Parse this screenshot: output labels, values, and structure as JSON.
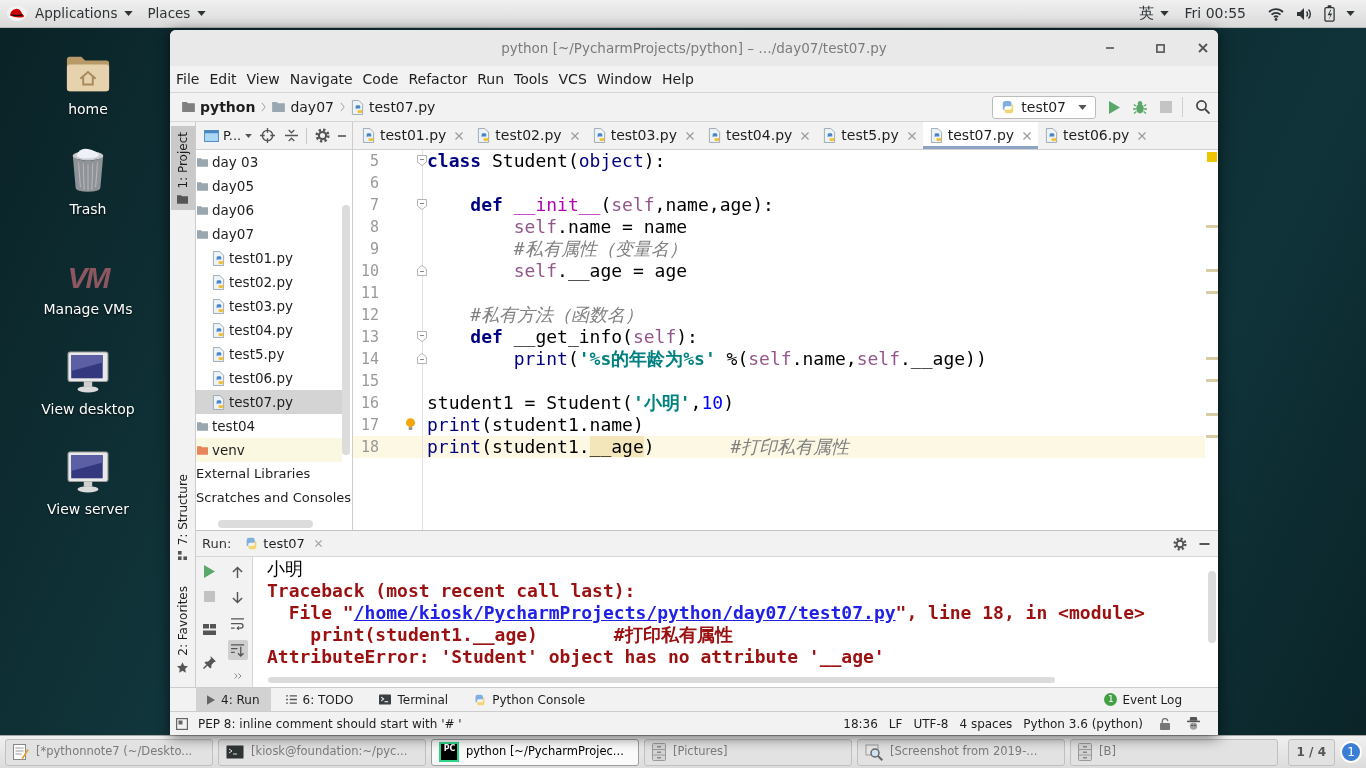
{
  "top_bar": {
    "menus": [
      "Applications",
      "Places"
    ],
    "input_method": "英",
    "clock": "Fri 00:55"
  },
  "desktop_icons": [
    {
      "kind": "home",
      "label": "home"
    },
    {
      "kind": "trash",
      "label": "Trash"
    },
    {
      "kind": "vm",
      "logo": "VM",
      "label": "Manage VMs"
    },
    {
      "kind": "monitor",
      "label": "View desktop"
    },
    {
      "kind": "monitor",
      "label": "View server"
    }
  ],
  "window": {
    "title": "python [~/PycharmProjects/python] – …/day07/test07.py",
    "menu": [
      "File",
      "Edit",
      "View",
      "Navigate",
      "Code",
      "Refactor",
      "Run",
      "Tools",
      "VCS",
      "Window",
      "Help"
    ],
    "breadcrumbs": [
      {
        "kind": "project",
        "label": "python"
      },
      {
        "kind": "folder",
        "label": "day07"
      },
      {
        "kind": "python_file",
        "label": "test07.py"
      }
    ],
    "run_config": "test07",
    "toolbar": [
      {
        "kind": "run",
        "disabled": false
      },
      {
        "kind": "debug",
        "disabled": false
      },
      {
        "kind": "stop",
        "disabled": true
      },
      {
        "kind": "search",
        "disabled": false
      }
    ],
    "side_tabs": [
      {
        "kind": "project",
        "label": "1: Project",
        "selected": true
      },
      {
        "kind": "structure",
        "label": "7: Structure",
        "selected": false
      },
      {
        "kind": "favorites",
        "label": "2: Favorites",
        "selected": false
      }
    ],
    "project_panel": {
      "view": "P...",
      "tree": [
        {
          "kind": "folder",
          "label": "day 03",
          "selected": false
        },
        {
          "kind": "folder",
          "label": "day05",
          "selected": false
        },
        {
          "kind": "folder",
          "label": "day06",
          "selected": false
        },
        {
          "kind": "folder",
          "label": "day07",
          "selected": false,
          "children": [
            {
              "kind": "python_file",
              "label": "test01.py",
              "selected": false
            },
            {
              "kind": "python_file",
              "label": "test02.py",
              "selected": false
            },
            {
              "kind": "python_file",
              "label": "test03.py",
              "selected": false
            },
            {
              "kind": "python_file",
              "label": "test04.py",
              "selected": false
            },
            {
              "kind": "python_file",
              "label": "test5.py",
              "selected": false
            },
            {
              "kind": "python_file",
              "label": "test06.py",
              "selected": false
            },
            {
              "kind": "python_file",
              "label": "test07.py",
              "selected": true
            }
          ]
        },
        {
          "kind": "folder",
          "label": "test04",
          "selected": false
        },
        {
          "kind": "excluded_folder",
          "label": "venv",
          "selected": false
        },
        {
          "kind": "libraries",
          "label": "External Libraries",
          "selected": false
        },
        {
          "kind": "scratches",
          "label": "Scratches and Consoles",
          "selected": false
        }
      ]
    },
    "editor_tabs": [
      {
        "label": "test01.py",
        "selected": false
      },
      {
        "label": "test02.py",
        "selected": false
      },
      {
        "label": "test03.py",
        "selected": false
      },
      {
        "label": "test04.py",
        "selected": false
      },
      {
        "label": "test5.py",
        "selected": false
      },
      {
        "label": "test07.py",
        "selected": true
      },
      {
        "label": "test06.py",
        "selected": false
      }
    ],
    "editor": {
      "lines": [
        {
          "number": "5",
          "fold_start": true,
          "tokens": [
            {
              "kind": "keyword",
              "text": "class "
            },
            {
              "kind": "plain",
              "text": "Student("
            },
            {
              "kind": "builtin",
              "text": "object"
            },
            {
              "kind": "plain",
              "text": "):"
            }
          ]
        },
        {
          "number": "6"
        },
        {
          "number": "7",
          "fold_start": true,
          "tokens": [
            {
              "kind": "keyword",
              "text": "    def "
            },
            {
              "kind": "magic",
              "text": "__init__"
            },
            {
              "kind": "plain",
              "text": "("
            },
            {
              "kind": "self",
              "text": "self"
            },
            {
              "kind": "plain",
              "text": ",name,age):"
            }
          ]
        },
        {
          "number": "8",
          "tokens": [
            {
              "kind": "self",
              "text": "        self"
            },
            {
              "kind": "plain",
              "text": ".name = name"
            }
          ]
        },
        {
          "number": "9",
          "tokens": [
            {
              "kind": "comment",
              "text": "        #私有属性（变量名）"
            }
          ]
        },
        {
          "number": "10",
          "fold_end": true,
          "tokens": [
            {
              "kind": "self",
              "text": "        self"
            },
            {
              "kind": "plain",
              "text": ".__age = age"
            }
          ]
        },
        {
          "number": "11"
        },
        {
          "number": "12",
          "tokens": [
            {
              "kind": "comment",
              "text": "    #私有方法（函数名）"
            }
          ]
        },
        {
          "number": "13",
          "fold_start": true,
          "tokens": [
            {
              "kind": "keyword",
              "text": "    def "
            },
            {
              "kind": "plain",
              "text": "__get_info("
            },
            {
              "kind": "self",
              "text": "self"
            },
            {
              "kind": "plain",
              "text": "):"
            }
          ]
        },
        {
          "number": "14",
          "fold_end": true,
          "tokens": [
            {
              "kind": "builtin",
              "text": "        print"
            },
            {
              "kind": "plain",
              "text": "("
            },
            {
              "kind": "string",
              "text": "'%s的年龄为%s'"
            },
            {
              "kind": "plain",
              "text": " %("
            },
            {
              "kind": "self",
              "text": "self"
            },
            {
              "kind": "plain",
              "text": ".name,"
            },
            {
              "kind": "self",
              "text": "self"
            },
            {
              "kind": "plain",
              "text": ".__age))"
            }
          ]
        },
        {
          "number": "15"
        },
        {
          "number": "16",
          "tokens": [
            {
              "kind": "plain",
              "text": "student1 = Student("
            },
            {
              "kind": "string",
              "text": "'小明'"
            },
            {
              "kind": "plain",
              "text": ","
            },
            {
              "kind": "number",
              "text": "10"
            },
            {
              "kind": "plain",
              "text": ")"
            }
          ]
        },
        {
          "number": "17",
          "bulb": true,
          "tokens": [
            {
              "kind": "builtin",
              "text": "print"
            },
            {
              "kind": "plain",
              "text": "(student1.name)"
            }
          ]
        },
        {
          "number": "18",
          "current": true,
          "tokens": [
            {
              "kind": "builtin",
              "text": "print"
            },
            {
              "kind": "plain",
              "text": "(student1."
            },
            {
              "kind": "unresolved",
              "text": "__age"
            },
            {
              "kind": "plain",
              "text": ")       "
            },
            {
              "kind": "comment",
              "text": "#打印私有属性"
            }
          ]
        }
      ]
    },
    "run_panel": {
      "label": "Run:",
      "tab": "test07",
      "actions": [
        {
          "kind": "rerun",
          "disabled": false
        },
        {
          "kind": "stop",
          "disabled": true
        },
        {
          "kind": "layout",
          "disabled": false
        },
        {
          "kind": "pin",
          "disabled": false
        }
      ],
      "options": [
        {
          "kind": "up",
          "on": false
        },
        {
          "kind": "down",
          "on": false
        },
        {
          "kind": "wrap",
          "on": false
        },
        {
          "kind": "scroll_end",
          "on": true
        },
        {
          "kind": "more",
          "on": false
        }
      ],
      "output": [
        {
          "kind": "stdout",
          "segments": [
            {
              "kind": "text",
              "text": "小明"
            }
          ]
        },
        {
          "kind": "stderr",
          "segments": [
            {
              "kind": "text",
              "text": "Traceback (most recent call last):"
            }
          ]
        },
        {
          "kind": "stderr",
          "segments": [
            {
              "kind": "text",
              "text": "  File \""
            },
            {
              "kind": "link",
              "text": "/home/kiosk/PycharmProjects/python/day07/test07.py"
            },
            {
              "kind": "text",
              "text": "\", line 18, in <module>"
            }
          ]
        },
        {
          "kind": "stderr",
          "segments": [
            {
              "kind": "text",
              "text": "    print(student1.__age)       #打印私有属性"
            }
          ]
        },
        {
          "kind": "stderr",
          "segments": [
            {
              "kind": "text",
              "text": "AttributeError: 'Student' object has no attribute '__age'"
            }
          ]
        }
      ]
    },
    "tool_windows": [
      {
        "kind": "run",
        "label": "4: Run",
        "selected": true
      },
      {
        "kind": "todo",
        "label": "6: TODO",
        "selected": false
      },
      {
        "kind": "terminal",
        "label": "Terminal",
        "selected": false
      },
      {
        "kind": "console",
        "label": "Python Console",
        "selected": false
      }
    ],
    "event_log": {
      "label": "Event Log",
      "count": "1"
    },
    "status_bar": {
      "message": "PEP 8: inline comment should start with '# '",
      "items": [
        "18:36",
        "LF",
        "UTF-8",
        "4 spaces",
        "Python 3.6 (python)"
      ]
    }
  },
  "taskbar": {
    "items": [
      {
        "kind": "editor",
        "label": "[*pythonnote7 (~/Deskto...",
        "selected": false
      },
      {
        "kind": "terminal",
        "label": "[kiosk@foundation:~/pyc...",
        "selected": false
      },
      {
        "kind": "pycharm",
        "logo": "PC",
        "label": "python [~/PycharmProjec...",
        "selected": true
      },
      {
        "kind": "files",
        "label": "[Pictures]",
        "selected": false
      },
      {
        "kind": "image_viewer",
        "label": "[Screenshot from 2019-...",
        "selected": false
      },
      {
        "kind": "files",
        "label": "[B]",
        "selected": false
      }
    ],
    "workspace": "1 / 4",
    "notifications": "1"
  }
}
